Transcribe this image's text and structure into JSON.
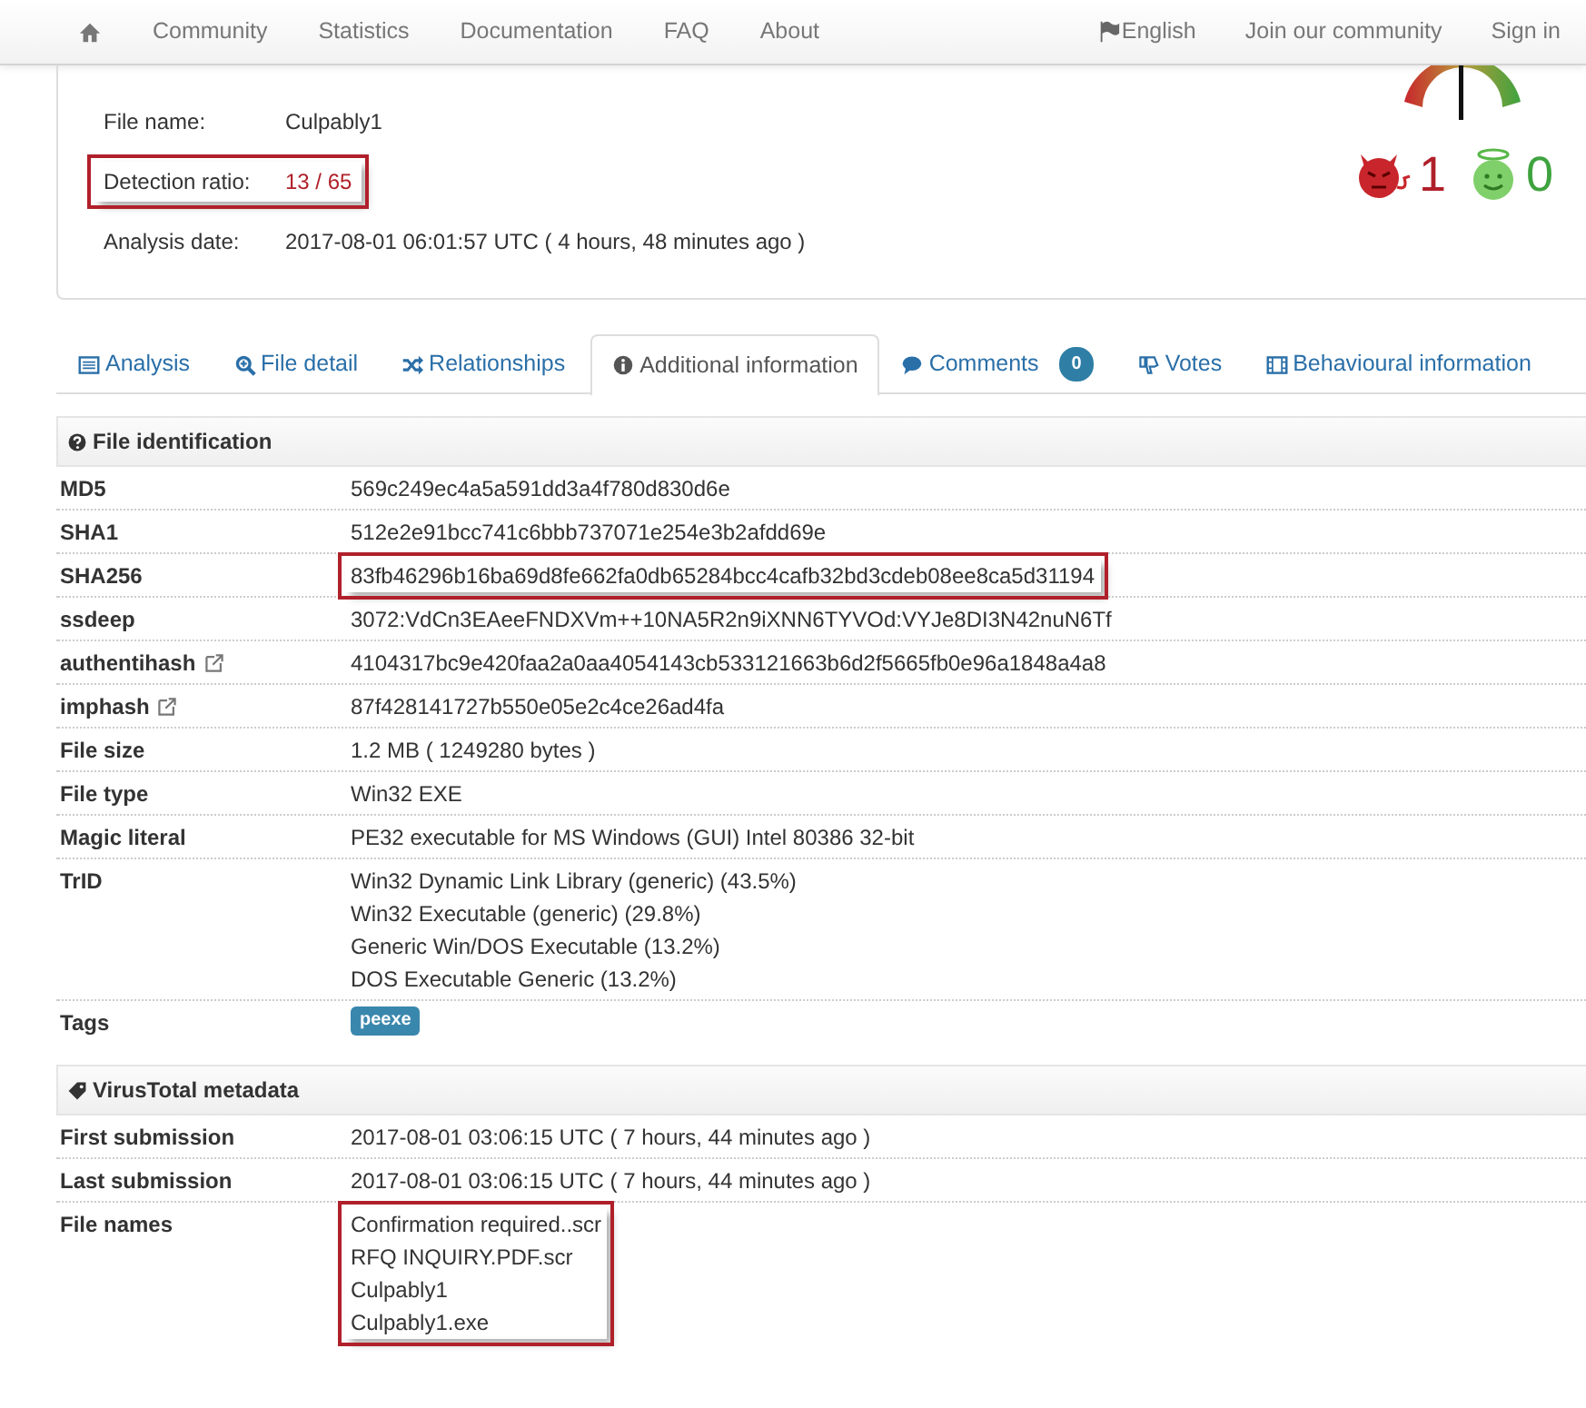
{
  "nav": {
    "left": [
      {
        "kind": "home"
      },
      {
        "label": "Community"
      },
      {
        "label": "Statistics"
      },
      {
        "label": "Documentation"
      },
      {
        "label": "FAQ"
      },
      {
        "label": "About"
      }
    ],
    "right": [
      {
        "label": "English",
        "kind": "flag"
      },
      {
        "label": "Join our community"
      },
      {
        "label": "Sign in"
      }
    ]
  },
  "summary": {
    "rows": [
      {
        "label": "File name:",
        "value": "Culpably1",
        "highlighted": false,
        "kind": "plain"
      },
      {
        "label": "Detection ratio:",
        "value": "13 / 65",
        "highlighted": true,
        "kind": "ratio"
      },
      {
        "label": "Analysis date:",
        "value": "2017-08-01 06:01:57 UTC ( 4 hours, 48 minutes ago )",
        "highlighted": false,
        "kind": "plain"
      }
    ],
    "votes": {
      "malicious": "1",
      "harmless": "0"
    }
  },
  "tabs": [
    {
      "label": "Analysis",
      "selected": false
    },
    {
      "label": "File detail",
      "selected": false
    },
    {
      "label": "Relationships",
      "selected": false
    },
    {
      "label": "Additional information",
      "selected": true
    },
    {
      "label": "Comments",
      "selected": false,
      "badge": "0"
    },
    {
      "label": "Votes",
      "selected": false
    },
    {
      "label": "Behavioural information",
      "selected": false
    }
  ],
  "sections": [
    {
      "title": "File identification",
      "rows": [
        {
          "label": "MD5",
          "values": [
            "569c249ec4a5a591dd3a4f780d830d6e"
          ],
          "highlighted": false
        },
        {
          "label": "SHA1",
          "values": [
            "512e2e91bcc741c6bbb737071e254e3b2afdd69e"
          ],
          "highlighted": false
        },
        {
          "label": "SHA256",
          "values": [
            "83fb46296b16ba69d8fe662fa0db65284bcc4cafb32bd3cdeb08ee8ca5d31194"
          ],
          "highlighted": true
        },
        {
          "label": "ssdeep",
          "values": [
            "3072:VdCn3EAeeFNDXVm++10NA5R2n9iXNN6TYVOd:VYJe8DI3N42nuN6Tf"
          ],
          "highlighted": false
        },
        {
          "label": "authentihash",
          "link": true,
          "values": [
            "4104317bc9e420faa2a0aa4054143cb533121663b6d2f5665fb0e96a1848a4a8"
          ],
          "highlighted": false
        },
        {
          "label": "imphash",
          "link": true,
          "values": [
            "87f428141727b550e05e2c4ce26ad4fa"
          ],
          "highlighted": false
        },
        {
          "label": "File size",
          "values": [
            "1.2 MB ( 1249280 bytes )"
          ],
          "highlighted": false
        },
        {
          "label": "File type",
          "values": [
            "Win32 EXE"
          ],
          "highlighted": false
        },
        {
          "label": "Magic literal",
          "values": [
            "PE32 executable for MS Windows (GUI) Intel 80386 32-bit"
          ],
          "highlighted": false
        },
        {
          "label": "TrID",
          "values": [
            "Win32 Dynamic Link Library (generic) (43.5%)",
            "Win32 Executable (generic) (29.8%)",
            "Generic Win/DOS Executable (13.2%)",
            "DOS Executable Generic (13.2%)"
          ],
          "highlighted": false
        },
        {
          "label": "Tags",
          "kind": "tags",
          "values": [
            "peexe"
          ],
          "highlighted": false
        }
      ]
    },
    {
      "title": "VirusTotal metadata",
      "rows": [
        {
          "label": "First submission",
          "values": [
            "2017-08-01 03:06:15 UTC ( 7 hours, 44 minutes ago )"
          ],
          "highlighted": false
        },
        {
          "label": "Last submission",
          "values": [
            "2017-08-01 03:06:15 UTC ( 7 hours, 44 minutes ago )"
          ],
          "highlighted": false
        },
        {
          "label": "File names",
          "values": [
            "Confirmation required..scr",
            "RFQ INQUIRY.PDF.scr",
            "Culpably1",
            "Culpably1.exe"
          ],
          "highlighted": true
        }
      ]
    }
  ]
}
